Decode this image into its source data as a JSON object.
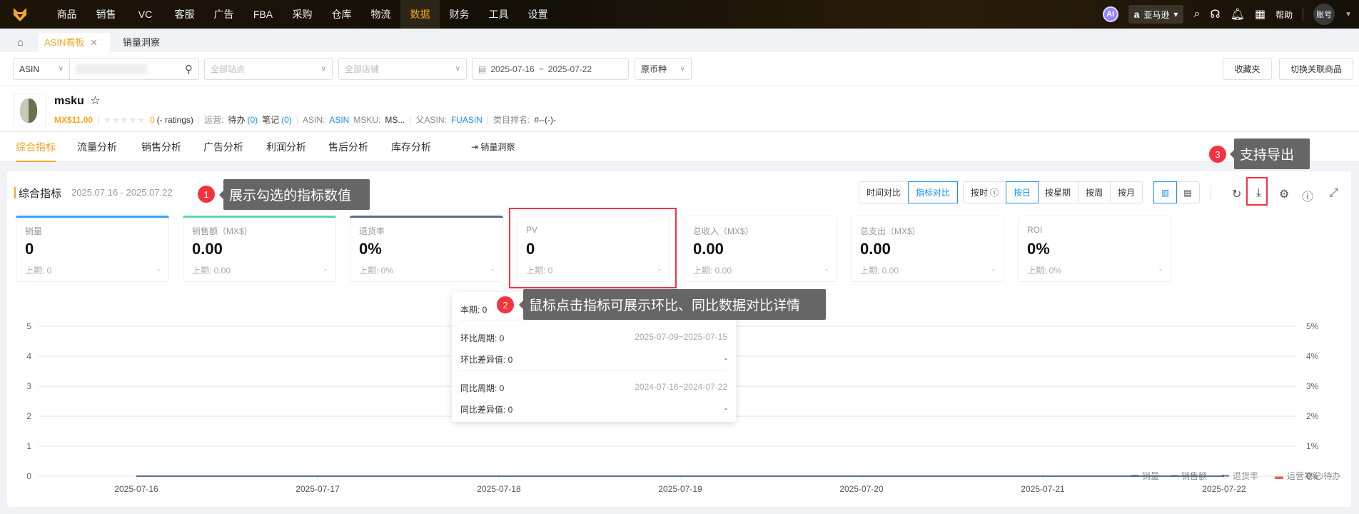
{
  "topnav": {
    "items": [
      "商品",
      "销售",
      "VC",
      "客服",
      "广告",
      "FBA",
      "采购",
      "仓库",
      "物流",
      "数据",
      "财务",
      "工具",
      "设置"
    ],
    "active": "数据",
    "ai": "AI",
    "marketplace": "亚马逊",
    "help": "帮助",
    "account": "账号"
  },
  "tabs": {
    "home_icon": "home-icon",
    "items": [
      {
        "label": "ASIN看板",
        "active": true
      },
      {
        "label": "销量洞察",
        "active": false
      }
    ]
  },
  "filters": {
    "search_type": "ASIN",
    "search_value": "",
    "site_placeholder": "全部站点",
    "store_placeholder": "全部店铺",
    "date_start": "2025-07-16",
    "date_sep": "~",
    "date_end": "2025-07-22",
    "currency": "原币种",
    "favorites": "收藏夹",
    "switch_product": "切换关联商品"
  },
  "product": {
    "title": "msku",
    "price": "MX$11.00",
    "rating_count": "0",
    "ratings_text": "(- ratings)",
    "ops_label": "运营:",
    "todo_label": "待办",
    "todo_count": "(0)",
    "notes_label": "笔记",
    "notes_count": "(0)",
    "asin_label": "ASIN:",
    "asin": "ASIN",
    "msku_label": "MSKU:",
    "msku": "MS...",
    "parent_label": "父ASIN:",
    "parent": "FUASIN",
    "rank_label": "类目排名:",
    "rank": "#--(-)-"
  },
  "subtabs": {
    "items": [
      "综合指标",
      "流量分析",
      "销售分析",
      "广告分析",
      "利润分析",
      "售后分析",
      "库存分析"
    ],
    "insight": "销量洞察"
  },
  "panel": {
    "title": "综合指标",
    "date_range": "2025.07.16 - 2025.07.22",
    "compare": [
      "时间对比",
      "指标对比"
    ],
    "granularity": [
      "按时",
      "按日",
      "按星期",
      "按周",
      "按月"
    ],
    "cards": [
      {
        "label": "销量",
        "value": "0",
        "prev": "上期: 0",
        "change": "-",
        "color": "#3aa0ff"
      },
      {
        "label": "销售额（MX$）",
        "value": "0.00",
        "prev": "上期: 0.00",
        "change": "-",
        "color": "#5fd9a5"
      },
      {
        "label": "退货率",
        "value": "0%",
        "prev": "上期: 0%",
        "change": "-",
        "color": "#5b6b94"
      },
      {
        "label": "PV",
        "value": "0",
        "prev": "上期: 0",
        "change": "-",
        "color": ""
      },
      {
        "label": "总收入（MX$）",
        "value": "0.00",
        "prev": "上期: 0.00",
        "change": "-",
        "color": ""
      },
      {
        "label": "总支出（MX$）",
        "value": "0.00",
        "prev": "上期: 0.00",
        "change": "-",
        "color": ""
      },
      {
        "label": "ROI",
        "value": "0%",
        "prev": "上期: 0%",
        "change": "-",
        "color": ""
      }
    ]
  },
  "popover": {
    "current": "本期: 0",
    "mom_period": "环比周期: 0",
    "mom_range": "2025-07-09~2025-07-15",
    "mom_diff": "环比差异值: 0",
    "mom_diff_r": "-",
    "yoy_period": "同比周期: 0",
    "yoy_range": "2024-07-16~2024-07-22",
    "yoy_diff": "同比差异值: 0",
    "yoy_diff_r": "-"
  },
  "annotations": [
    {
      "num": "1",
      "text": "展示勾选的指标数值"
    },
    {
      "num": "2",
      "text": "鼠标点击指标可展示环比、同比数据对比详情"
    },
    {
      "num": "3",
      "text": "支持导出"
    }
  ],
  "chart_data": {
    "type": "line",
    "x": [
      "2025-07-16",
      "2025-07-17",
      "2025-07-18",
      "2025-07-19",
      "2025-07-20",
      "2025-07-21",
      "2025-07-22"
    ],
    "series": [
      {
        "name": "销量",
        "color": "#3aa0ff",
        "values": [
          0,
          0,
          0,
          0,
          0,
          0,
          0
        ],
        "axis": "left"
      },
      {
        "name": "销售额",
        "color": "#5fd9a5",
        "values": [
          0,
          0,
          0,
          0,
          0,
          0,
          0
        ],
        "axis": "left"
      },
      {
        "name": "退货率",
        "color": "#5b6b94",
        "values": [
          0,
          0,
          0,
          0,
          0,
          0,
          0
        ],
        "axis": "right"
      }
    ],
    "notes_legend": "运营笔记/待办",
    "y_left_ticks": [
      "0",
      "1",
      "2",
      "3",
      "4",
      "5"
    ],
    "y_right_ticks": [
      "0%",
      "1%",
      "2%",
      "3%",
      "4%",
      "5%"
    ],
    "ylim_left": [
      0,
      5
    ],
    "ylim_right": [
      0,
      5
    ],
    "legend": "top-right",
    "grid": true
  }
}
